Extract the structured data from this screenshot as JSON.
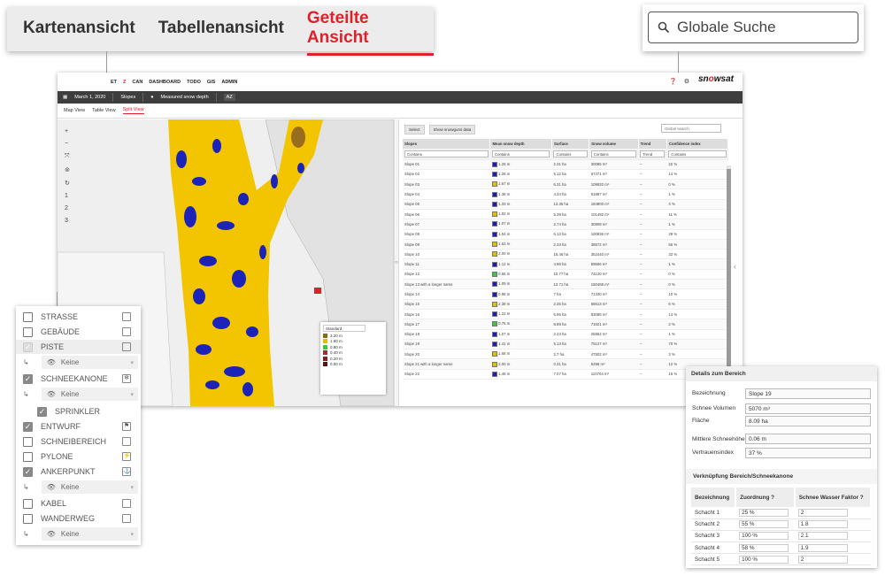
{
  "view_tabs": [
    {
      "label": "Kartenansicht",
      "active": false
    },
    {
      "label": "Tabellenansicht",
      "active": false
    },
    {
      "label": "Geteilte Ansicht",
      "active": true
    }
  ],
  "global_search": {
    "placeholder": "Globale Suche",
    "icon": "search-icon"
  },
  "app": {
    "nav": [
      "ET",
      "Z",
      "CAN",
      "DASHBOARD",
      "TODO",
      "GIS",
      "ADMIN"
    ],
    "logo": {
      "pre": "sn",
      "o": "o",
      "post": "wsat"
    },
    "toolbar": {
      "date": "March 1, 2020",
      "layer": "Slopes",
      "measure": "Measured snow depth",
      "az": "AZ"
    },
    "subtabs": [
      "Map View",
      "Table View",
      "Split View"
    ],
    "map_tools": [
      "+",
      "−",
      "⤧",
      "⊚",
      "↻",
      "1",
      "2",
      "3"
    ],
    "legend": {
      "select": "Standard",
      "entries": [
        {
          "color": "#8b6b1a",
          "label": "3.20 m"
        },
        {
          "color": "#e7bd00",
          "label": "1.60 m"
        },
        {
          "color": "#3cc63c",
          "label": "0.80 m"
        },
        {
          "color": "#a03030",
          "label": "0.40 m"
        },
        {
          "color": "#8a1c1c",
          "label": "0.20 m"
        },
        {
          "color": "#601010",
          "label": "0.00 m"
        }
      ]
    },
    "table_bar": {
      "select": "Select",
      "show": "Show snowguns data",
      "search": "Global search"
    },
    "columns": [
      "Slopes",
      "Mean snow depth",
      "Surface",
      "Snow volume",
      "Trend",
      "Confidence index"
    ],
    "filters": [
      "Contains",
      "Contains",
      "Contains",
      "Contains",
      "Trend",
      "Contains"
    ],
    "rows": [
      {
        "name": "Slope 01",
        "color": "#1b1bbf",
        "depth": "1.25 m",
        "surface": "2.31 ha",
        "volume": "30085 m³",
        "conf": "22 %"
      },
      {
        "name": "Slope 02",
        "color": "#1b1bbf",
        "depth": "1.28 m",
        "surface": "5.12 ha",
        "volume": "67471 m³",
        "conf": "14 %"
      },
      {
        "name": "Slope 03",
        "color": "#e7bd00",
        "depth": "1.67 m",
        "surface": "6.31 ha",
        "volume": "109820 m³",
        "conf": "0 %"
      },
      {
        "name": "Slope 04",
        "color": "#1b1bbf",
        "depth": "1.38 m",
        "surface": "4.34 ha",
        "volume": "61887 m³",
        "conf": "1 %"
      },
      {
        "name": "Slope 05",
        "color": "#1b1bbf",
        "depth": "1.33 m",
        "surface": "13.35 ha",
        "volume": "184800 m³",
        "conf": "4 %"
      },
      {
        "name": "Slope 06",
        "color": "#e7bd00",
        "depth": "1.82 m",
        "surface": "5.39 ha",
        "volume": "101492 m³",
        "conf": "11 %"
      },
      {
        "name": "Slope 07",
        "color": "#1b1bbf",
        "depth": "1.07 m",
        "surface": "2.74 ha",
        "volume": "30908 m³",
        "conf": "1 %"
      },
      {
        "name": "Slope 08",
        "color": "#1b1bbf",
        "depth": "1.54 m",
        "surface": "6.13 ha",
        "volume": "100836 m³",
        "conf": "29 %"
      },
      {
        "name": "Slope 09",
        "color": "#e7bd00",
        "depth": "1.63 m",
        "surface": "2.33 ha",
        "volume": "38572 m³",
        "conf": "56 %"
      },
      {
        "name": "Slope 10",
        "color": "#e7bd00",
        "depth": "2.00 m",
        "surface": "16.46 ha",
        "volume": "352440 m³",
        "conf": "32 %"
      },
      {
        "name": "Slope 11",
        "color": "#1b1bbf",
        "depth": "1.12 m",
        "surface": "4.96 ha",
        "volume": "59656 m³",
        "conf": "1 %"
      },
      {
        "name": "Slope 12",
        "color": "#3cc63c",
        "depth": "0.65 m",
        "surface": "10.77 ha",
        "volume": "74120 m³",
        "conf": "0 %"
      },
      {
        "name": "Slope 13 with a longer name",
        "color": "#1b1bbf",
        "depth": "1.09 m",
        "surface": "13.71 ha",
        "volume": "160468 m³",
        "conf": "0 %"
      },
      {
        "name": "Slope 14",
        "color": "#1b1bbf",
        "depth": "0.98 m",
        "surface": "7 ha",
        "volume": "71330 m³",
        "conf": "10 %"
      },
      {
        "name": "Slope 15",
        "color": "#e7bd00",
        "depth": "2.38 m",
        "surface": "2.35 ha",
        "volume": "65613 m³",
        "conf": "6 %"
      },
      {
        "name": "Slope 16",
        "color": "#1b1bbf",
        "depth": "1.22 m",
        "surface": "6.95 ha",
        "volume": "83085 m³",
        "conf": "14 %"
      },
      {
        "name": "Slope 17",
        "color": "#3cc63c",
        "depth": "0.75 m",
        "surface": "8.89 ha",
        "volume": "71621 m³",
        "conf": "2 %"
      },
      {
        "name": "Slope 18",
        "color": "#1b1bbf",
        "depth": "1.07 m",
        "surface": "2.23 ha",
        "volume": "25852 m³",
        "conf": "1 %"
      },
      {
        "name": "Slope 19",
        "color": "#1b1bbf",
        "depth": "1.41 m",
        "surface": "5.13 ha",
        "volume": "75127 m³",
        "conf": "70 %"
      },
      {
        "name": "Slope 20",
        "color": "#e7bd00",
        "depth": "1.68 m",
        "surface": "2.7 ha",
        "volume": "47502 m³",
        "conf": "3 %"
      },
      {
        "name": "Slope 21 with a longer name",
        "color": "#e7bd00",
        "depth": "2.00 m",
        "surface": "0.31 ha",
        "volume": "6296 m³",
        "conf": "12 %"
      },
      {
        "name": "Slope 22",
        "color": "#1b1bbf",
        "depth": "1.48 m",
        "surface": "7.07 ha",
        "volume": "110704 m³",
        "conf": "16 %"
      }
    ]
  },
  "layers": {
    "items": [
      {
        "label": "STRASSE",
        "checked": false,
        "icon": ""
      },
      {
        "label": "GEBÄUDE",
        "checked": false,
        "icon": ""
      },
      {
        "label": "PISTE",
        "checked": true,
        "icon": ""
      },
      {
        "label": "SCHNEEKANONE",
        "checked": true,
        "icon": "❄"
      },
      {
        "label": "SPRINKLER",
        "checked": true,
        "icon": ""
      },
      {
        "label": "ENTWURF",
        "checked": true,
        "icon": "⚑"
      },
      {
        "label": "SCHNEIBEREICH",
        "checked": false,
        "icon": ""
      },
      {
        "label": "PYLONE",
        "checked": false,
        "icon": "⚡"
      },
      {
        "label": "ANKERPUNKT",
        "checked": true,
        "icon": "⚓"
      },
      {
        "label": "KABEL",
        "checked": false,
        "icon": ""
      },
      {
        "label": "WANDERWEG",
        "checked": false,
        "icon": ""
      }
    ],
    "dropdown": "Keine"
  },
  "details": {
    "title": "Details zum Bereich",
    "fields": [
      {
        "label": "Bezeichnung",
        "value": "Slope 19"
      },
      {
        "label": "Schnee Volumen",
        "value": "5070 m³"
      },
      {
        "label": "Fläche",
        "value": "8.09 ha"
      },
      {
        "label": "Mittlere Schneehöhe",
        "value": "0.06 m"
      },
      {
        "label": "Vertrauensindex",
        "value": "37 %"
      }
    ],
    "link_title": "Verknüpfung Bereich/Schneekanone",
    "link_cols": [
      "Bezeichnung",
      "Zuordnung",
      "Schnee Wasser Faktor"
    ],
    "link_rows": [
      {
        "name": "Schacht 1",
        "zu": "25 %",
        "f": "2"
      },
      {
        "name": "Schacht 2",
        "zu": "55 %",
        "f": "1.8"
      },
      {
        "name": "Schacht 3",
        "zu": "100 %",
        "f": "2.1"
      },
      {
        "name": "Schacht 4",
        "zu": "58 %",
        "f": "1.9"
      },
      {
        "name": "Schacht 5",
        "zu": "100 %",
        "f": "2"
      }
    ]
  }
}
